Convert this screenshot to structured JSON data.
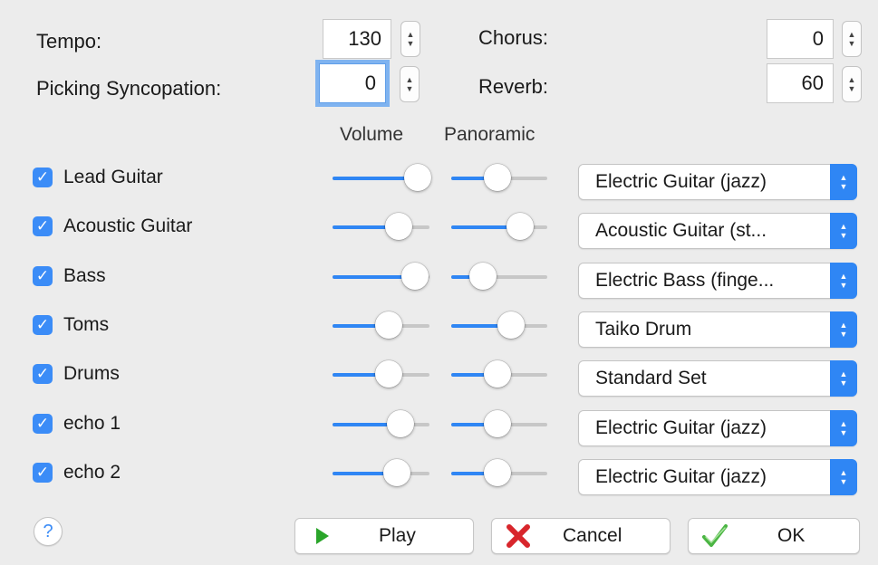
{
  "settings": {
    "tempo_label": "Tempo:",
    "tempo_value": "130",
    "syncopation_label": "Picking Syncopation:",
    "syncopation_value": "0",
    "chorus_label": "Chorus:",
    "chorus_value": "0",
    "reverb_label": "Reverb:",
    "reverb_value": "60"
  },
  "columns": {
    "volume": "Volume",
    "panoramic": "Panoramic"
  },
  "checkmark": "✓",
  "tracks": [
    {
      "name": "Lead Guitar",
      "checked": true,
      "volume": 0.88,
      "pan": 0.48,
      "instrument": "Electric Guitar (jazz)"
    },
    {
      "name": "Acoustic Guitar",
      "checked": true,
      "volume": 0.68,
      "pan": 0.72,
      "instrument": "Acoustic Guitar (st..."
    },
    {
      "name": "Bass",
      "checked": true,
      "volume": 0.85,
      "pan": 0.33,
      "instrument": "Electric Bass (finge..."
    },
    {
      "name": "Toms",
      "checked": true,
      "volume": 0.58,
      "pan": 0.62,
      "instrument": "Taiko Drum"
    },
    {
      "name": "Drums",
      "checked": true,
      "volume": 0.58,
      "pan": 0.48,
      "instrument": "Standard Set"
    },
    {
      "name": "echo 1",
      "checked": true,
      "volume": 0.7,
      "pan": 0.48,
      "instrument": "Electric Guitar (jazz)"
    },
    {
      "name": "echo 2",
      "checked": true,
      "volume": 0.66,
      "pan": 0.48,
      "instrument": "Electric Guitar (jazz)"
    }
  ],
  "buttons": {
    "help": "?",
    "play": "Play",
    "cancel": "Cancel",
    "ok": "OK"
  },
  "icons": {
    "play": "play-icon",
    "cancel": "cancel-x-icon",
    "ok": "checkmark-icon",
    "stepper": "stepper-arrows-icon",
    "popup": "popup-arrows-icon"
  },
  "colors": {
    "accent": "#2f86f4",
    "play_green": "#2aa52a",
    "cancel_red": "#d8262c",
    "ok_green": "#4bb543"
  }
}
